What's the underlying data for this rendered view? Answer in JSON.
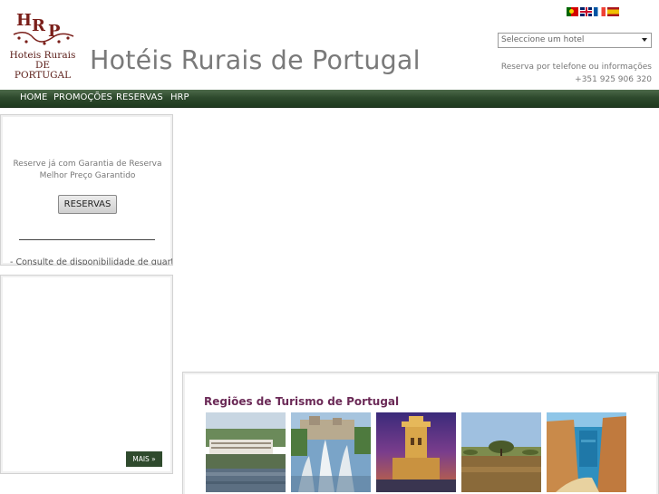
{
  "logo": {
    "monogram": "HRP",
    "line1": "Hoteis Rurais",
    "line2": "DE PORTUGAL"
  },
  "site_title": "Hotéis Rurais de Portugal",
  "languages": [
    {
      "code": "pt",
      "icon": "portugal-flag-icon"
    },
    {
      "code": "en",
      "icon": "uk-flag-icon"
    },
    {
      "code": "fr",
      "icon": "france-flag-icon"
    },
    {
      "code": "es",
      "icon": "spain-flag-icon"
    }
  ],
  "hotel_select": {
    "value": "Seleccione um hotel",
    "icon": "dropdown-arrow-icon"
  },
  "contact": {
    "line1": "Reserva por telefone ou informações",
    "phone": "+351 925 906 320"
  },
  "nav": {
    "items": [
      {
        "label": "HOME"
      },
      {
        "label": "PROMOÇÕES"
      },
      {
        "label": "RESERVAS"
      },
      {
        "label": "HRP"
      }
    ]
  },
  "reservations_box": {
    "line1": "Reserve já com Garantia de Reserva",
    "line2": "Melhor Preço Garantido",
    "button": "RESERVAS",
    "cut_text": "- Consulte de disponibilidade de quartos"
  },
  "news_box": {
    "more_button": "MAIS »"
  },
  "regions": {
    "title": "Regiões de Turismo de Portugal",
    "thumbnails": [
      {
        "name": "region-thumb-1"
      },
      {
        "name": "region-thumb-2"
      },
      {
        "name": "region-thumb-3"
      },
      {
        "name": "region-thumb-4"
      },
      {
        "name": "region-thumb-5"
      }
    ]
  },
  "colors": {
    "nav_bar": "#2e4a2d",
    "title_purple": "#6b2a57",
    "logo_red": "#7a1f1a"
  }
}
